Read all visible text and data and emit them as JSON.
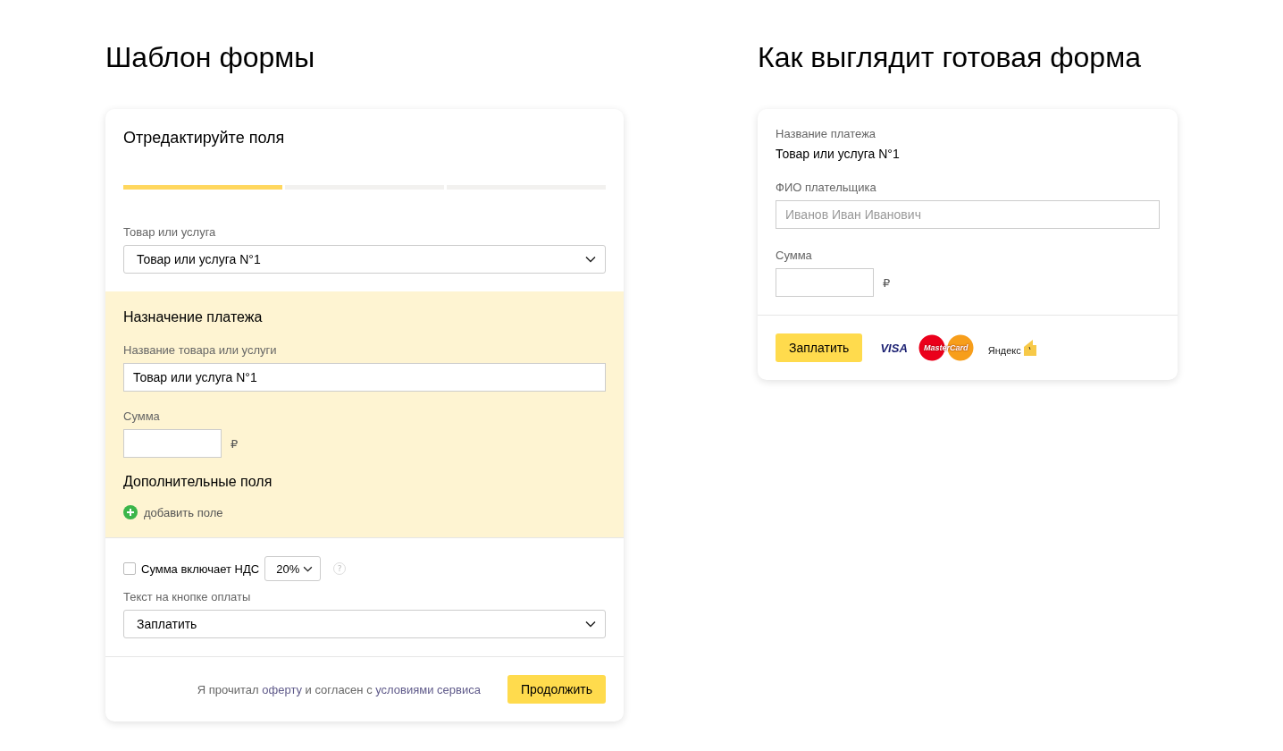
{
  "template": {
    "title": "Шаблон формы",
    "heading": "Отредактируйте поля",
    "steps": [
      {
        "done": true
      },
      {
        "done": false
      },
      {
        "done": false
      }
    ],
    "product_select": {
      "label": "Товар или услуга",
      "value": "Товар или услуга N°1"
    },
    "purpose": {
      "heading": "Назначение платежа",
      "name_label": "Название товара или услуги",
      "name_value": "Товар или услуга N°1",
      "sum_label": "Сумма",
      "currency": "₽",
      "extra_heading": "Дополнительные поля",
      "add_field": "добавить поле"
    },
    "vat": {
      "label": "Сумма включает НДС",
      "checked": false,
      "rate": "20%",
      "help": "?"
    },
    "button_text_select": {
      "label": "Текст на кнопке оплаты",
      "value": "Заплатить"
    },
    "agreement": [
      {
        "text": "Я прочитал ",
        "link": false
      },
      {
        "text": "оферту",
        "link": true
      },
      {
        "text": " и согласен с ",
        "link": false
      },
      {
        "text": "условиями сервиса",
        "link": true
      }
    ],
    "continue_button": "Продолжить"
  },
  "preview": {
    "title": "Как выглядит готовая форма",
    "payment_label": "Название платежа",
    "payment_name": "Товар или услуга N°1",
    "payer_label": "ФИО плательщика",
    "payer_placeholder": "Иванов Иван Иванович",
    "sum_label": "Сумма",
    "currency": "₽",
    "pay_button": "Заплатить",
    "logos": [
      {
        "kind": "visa",
        "text": "VISA"
      },
      {
        "kind": "mastercard",
        "text": "MasterCard"
      },
      {
        "kind": "yandex",
        "text": "Яндекс"
      }
    ]
  }
}
